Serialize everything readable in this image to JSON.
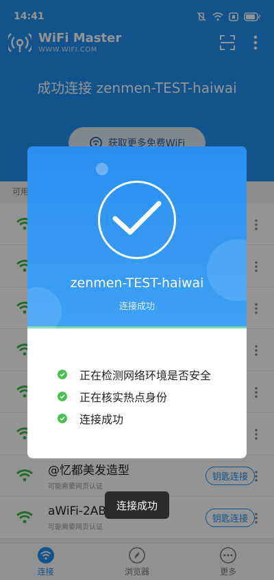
{
  "status_bar": {
    "time": "14:41"
  },
  "header": {
    "app_name": "WiFi Master",
    "app_url": "WWW.WIFI.COM",
    "connected_title": "成功连接 zenmen-TEST-haiwai",
    "free_wifi_button": "获取更多免费WiFi"
  },
  "list": {
    "label": "可用",
    "rows": [
      {
        "name": "",
        "sub": "",
        "key_label": ""
      },
      {
        "name": "",
        "sub": "",
        "key_label": ""
      },
      {
        "name": "",
        "sub": "",
        "key_label": ""
      },
      {
        "name": "",
        "sub": "",
        "key_label": ""
      },
      {
        "name": "",
        "sub": "",
        "key_label": ""
      },
      {
        "name": "",
        "sub": "",
        "key_label": ""
      },
      {
        "name": "@忆都美发造型",
        "sub": "可能需要网页认证",
        "key_label": "钥匙连接"
      },
      {
        "name": "aWiFi-2AB",
        "sub": "可能需要网页认证",
        "key_label": "钥匙连接"
      }
    ]
  },
  "dialog": {
    "ssid": "zenmen-TEST-haiwai",
    "status": "连接成功",
    "steps": [
      "正在检测网络环境是否安全",
      "正在核实热点身份",
      "连接成功"
    ]
  },
  "toast": "连接成功",
  "tabs": [
    {
      "label": "连接",
      "icon": "wifi-icon"
    },
    {
      "label": "浏览器",
      "icon": "compass-icon"
    },
    {
      "label": "更多",
      "icon": "more-icon"
    }
  ],
  "colors": {
    "primary": "#1f8ff0",
    "success": "#4cbf52"
  }
}
